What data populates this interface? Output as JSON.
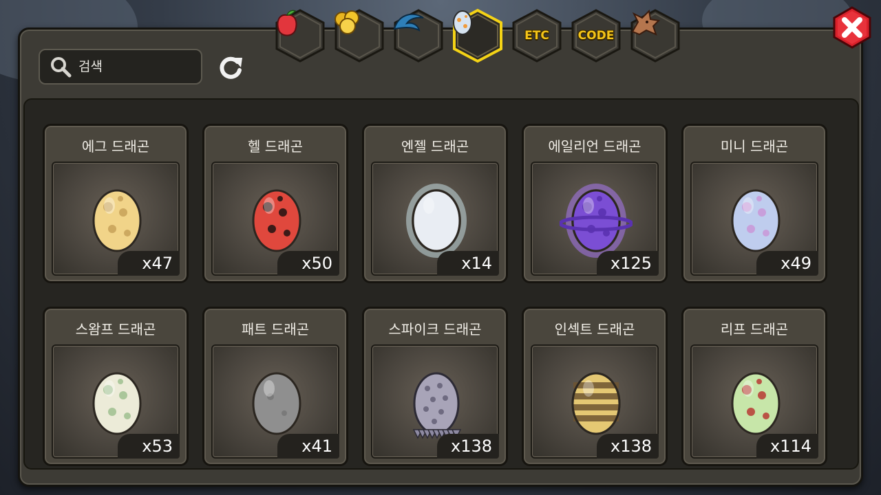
{
  "search": {
    "placeholder": "검색"
  },
  "tabs": [
    {
      "icon": "fruit-icon"
    },
    {
      "icon": "gold-icon"
    },
    {
      "icon": "claw-icon"
    },
    {
      "icon": "egg-icon",
      "selected": true
    },
    {
      "label": "ETC"
    },
    {
      "label": "CODE"
    },
    {
      "icon": "dragon-head-icon"
    }
  ],
  "colors": {
    "tab_selected": "#f4d316",
    "tab_text": "#f4c419",
    "close_red": "#d8202a"
  },
  "cards": [
    {
      "name": "에그 드래곤",
      "count": "x47",
      "egg": "egg-dragon-egg",
      "base": "#f1d489",
      "spot": "#c9a45c"
    },
    {
      "name": "헬 드래곤",
      "count": "x50",
      "egg": "hell-dragon-egg",
      "base": "#e0483d",
      "spot": "#2a1614"
    },
    {
      "name": "엔젤 드래곤",
      "count": "x14",
      "egg": "angel-dragon-egg",
      "base": "#e9edf3",
      "spot": "#ffffff"
    },
    {
      "name": "에일리언 드래곤",
      "count": "x125",
      "egg": "alien-dragon-egg",
      "base": "#7b4ed4",
      "spot": "#5a32b0"
    },
    {
      "name": "미니 드래곤",
      "count": "x49",
      "egg": "mini-dragon-egg",
      "base": "#bfcdee",
      "spot": "#c99ad8"
    },
    {
      "name": "스왐프 드래곤",
      "count": "x53",
      "egg": "swamp-dragon-egg",
      "base": "#ecebd8",
      "spot": "#a3c294"
    },
    {
      "name": "패트 드래곤",
      "count": "x41",
      "egg": "fat-dragon-egg",
      "base": "#8f8f8f",
      "spot": "#7a7a7a"
    },
    {
      "name": "스파이크 드래곤",
      "count": "x138",
      "egg": "spike-dragon-egg",
      "base": "#a8a4b8",
      "spot": "#6e6a80"
    },
    {
      "name": "인섹트 드래곤",
      "count": "x138",
      "egg": "insect-dragon-egg",
      "base": "#e5c873",
      "spot": "#6f5530"
    },
    {
      "name": "리프 드래곤",
      "count": "x114",
      "egg": "leaf-dragon-egg",
      "base": "#c7e6a9",
      "spot": "#b8423a"
    }
  ]
}
